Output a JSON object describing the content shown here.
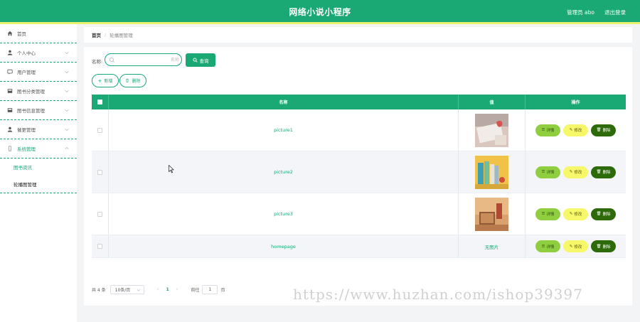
{
  "header": {
    "title": "网络小说小程序",
    "user": "管理员 abo",
    "logout": "退出登录"
  },
  "sidebar": {
    "items": [
      {
        "label": "首页",
        "icon": "home-icon"
      },
      {
        "label": "个人中心",
        "icon": "person-icon"
      },
      {
        "label": "用户管理",
        "icon": "chat-icon"
      },
      {
        "label": "图书分类管理",
        "icon": "book-icon"
      },
      {
        "label": "图书信息管理",
        "icon": "book-icon"
      },
      {
        "label": "催更管理",
        "icon": "person-icon"
      },
      {
        "label": "系统管理",
        "icon": "phone-icon"
      }
    ],
    "submenu": [
      {
        "label": "图书资讯"
      },
      {
        "label": "轮播图管理"
      }
    ]
  },
  "breadcrumb": {
    "home": "首页",
    "separator": "/",
    "current": "轮播图管理"
  },
  "search": {
    "label": "名称",
    "placeholder": "名称",
    "button": "查询"
  },
  "actions": {
    "add": "新增",
    "delete": "删除"
  },
  "table": {
    "headers": {
      "name": "名称",
      "image": "值",
      "ops": "操作"
    },
    "rows": [
      {
        "name": "picture1",
        "image": "thumb-1"
      },
      {
        "name": "picture2",
        "image": "thumb-2"
      },
      {
        "name": "picture3",
        "image": "thumb-3"
      },
      {
        "name": "homepage",
        "image_text": "无图片"
      }
    ],
    "op_labels": {
      "detail": "详情",
      "edit": "修改",
      "delete": "删除"
    }
  },
  "pagination": {
    "total": "共 4 条",
    "page_size": "10条/页",
    "current_page": "1",
    "goto_prefix": "前往",
    "goto_value": "1",
    "goto_suffix": "页"
  },
  "watermark": "https://www.huzhan.com/ishop39397",
  "colors": {
    "primary": "#1aa875",
    "accent_yellow": "#e9f26a",
    "detail": "#8fce3f",
    "edit": "#f7f76a",
    "delete": "#2d6b0a"
  }
}
